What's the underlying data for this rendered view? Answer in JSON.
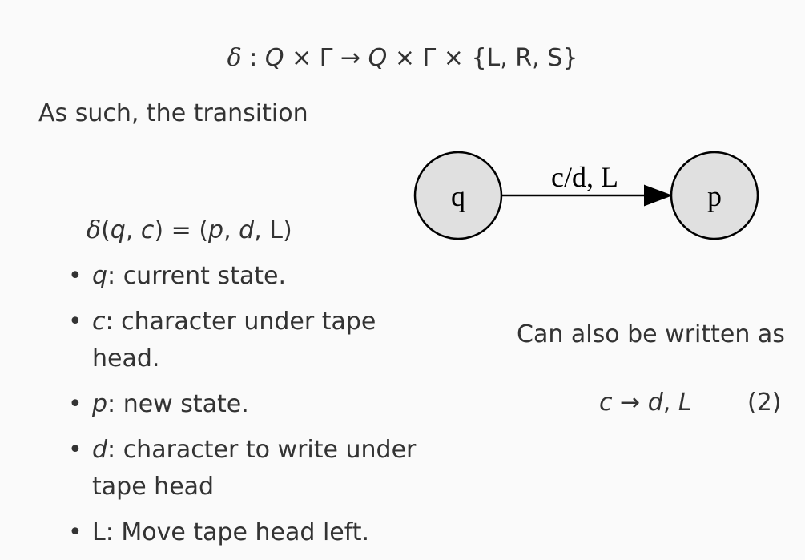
{
  "formula": {
    "delta": "δ",
    "colon": " : ",
    "q1": "Q",
    "times1": " × ",
    "gamma1": "Γ",
    "arrow": " → ",
    "q2": "Q",
    "times2": " × ",
    "gamma2": "Γ",
    "times3": " × ",
    "set": "{L, R, S}"
  },
  "intro_text": "As such, the transition",
  "diagram": {
    "from_state": "q",
    "to_state": "p",
    "edge_label": "c/d, L"
  },
  "transition_eq": {
    "delta": "δ",
    "lhs_open": "(",
    "q": "q",
    "comma1": ", ",
    "c": "c",
    "lhs_close": ") = (",
    "p": "p",
    "comma2": ", ",
    "d": "d",
    "comma3": ", ",
    "L": "L",
    "rhs_close": ")"
  },
  "bullets": [
    {
      "sym": "q",
      "text": ": current state."
    },
    {
      "sym": "c",
      "text": ": character under tape head."
    },
    {
      "sym": "p",
      "text": ": new state."
    },
    {
      "sym": "d",
      "text": ": character to write under tape head"
    },
    {
      "sym": "L",
      "text": ": Move tape head left."
    }
  ],
  "also_text": "Can also be written as",
  "equation2": {
    "c": "c",
    "arrow": " → ",
    "d": "d",
    "comma": ", ",
    "L": "L",
    "number": "(2)"
  }
}
